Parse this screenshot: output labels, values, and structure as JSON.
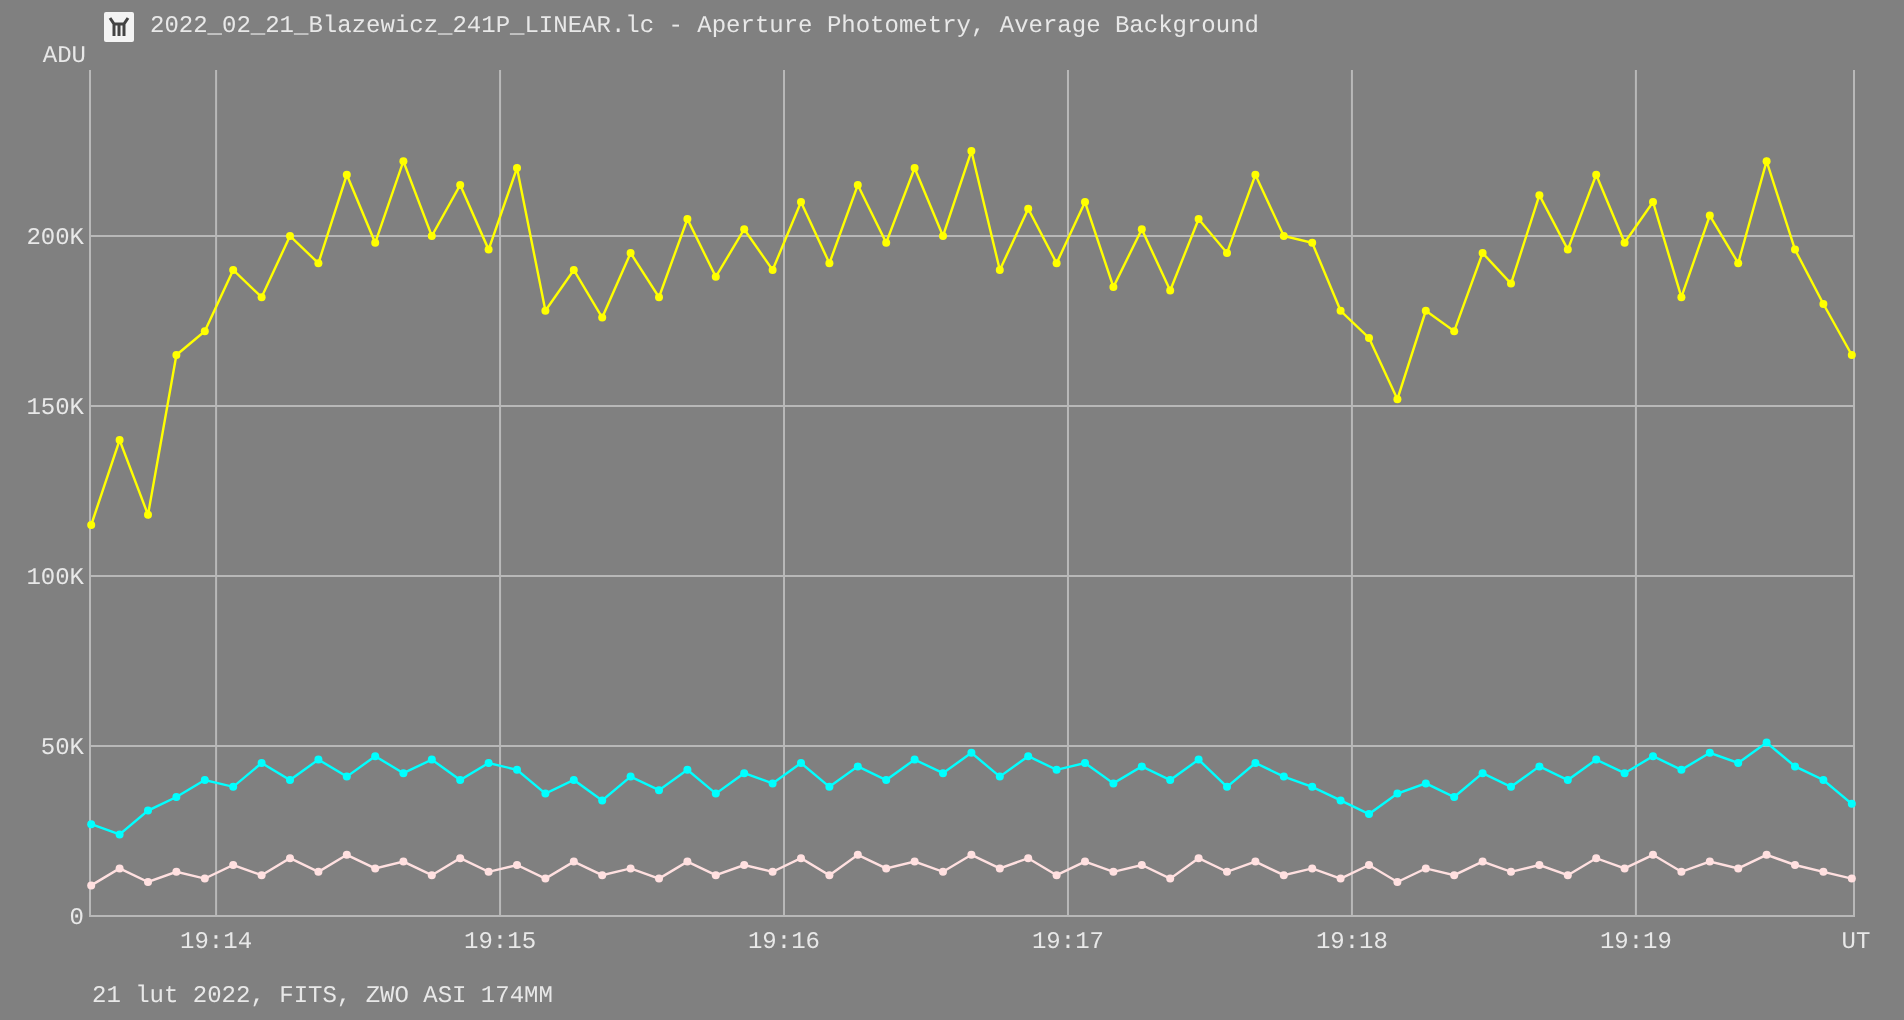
{
  "window": {
    "title": "2022_02_21_Blazewicz_241P_LINEAR.lc - Aperture Photometry, Average Background"
  },
  "chart": {
    "chart_data": {
      "type": "line",
      "grid": true,
      "ylabel": "ADU",
      "xlabel": "UT",
      "xlim": [
        1153.556,
        1159.768
      ],
      "ylim": [
        0,
        248800
      ],
      "x": [
        1153.56,
        1153.66,
        1153.76,
        1153.86,
        1153.96,
        1154.06,
        1154.16,
        1154.26,
        1154.36,
        1154.46,
        1154.56,
        1154.66,
        1154.76,
        1154.86,
        1154.96,
        1155.06,
        1155.16,
        1155.26,
        1155.36,
        1155.46,
        1155.56,
        1155.66,
        1155.76,
        1155.86,
        1155.96,
        1156.06,
        1156.16,
        1156.26,
        1156.36,
        1156.46,
        1156.56,
        1156.66,
        1156.76,
        1156.86,
        1156.96,
        1157.06,
        1157.16,
        1157.26,
        1157.36,
        1157.46,
        1157.56,
        1157.66,
        1157.76,
        1157.86,
        1157.96,
        1158.06,
        1158.16,
        1158.26,
        1158.36,
        1158.46,
        1158.56,
        1158.66,
        1158.76,
        1158.86,
        1158.96,
        1159.06,
        1159.16,
        1159.26,
        1159.36,
        1159.46,
        1159.56,
        1159.66,
        1159.76
      ],
      "xticks": [
        {
          "value": 1154,
          "label": "19:14"
        },
        {
          "value": 1155,
          "label": "19:15"
        },
        {
          "value": 1156,
          "label": "19:16"
        },
        {
          "value": 1157,
          "label": "19:17"
        },
        {
          "value": 1158,
          "label": "19:18"
        },
        {
          "value": 1159,
          "label": "19:19"
        }
      ],
      "yticks": [
        0,
        {
          "value": 50000,
          "label": "50K"
        },
        {
          "value": 100000,
          "label": "100K"
        },
        {
          "value": 150000,
          "label": "150K"
        },
        {
          "value": 200000,
          "label": "200K"
        }
      ],
      "series": [
        {
          "color": "#ffff00",
          "values": [
            115000,
            140000,
            118000,
            165000,
            172000,
            190000,
            182000,
            200000,
            192000,
            218000,
            198000,
            222000,
            200000,
            215000,
            196000,
            220000,
            178000,
            190000,
            176000,
            195000,
            182000,
            205000,
            188000,
            202000,
            190000,
            210000,
            192000,
            215000,
            198000,
            220000,
            200000,
            225000,
            190000,
            208000,
            192000,
            210000,
            185000,
            202000,
            184000,
            205000,
            195000,
            218000,
            200000,
            198000,
            178000,
            170000,
            152000,
            178000,
            172000,
            195000,
            186000,
            212000,
            196000,
            218000,
            198000,
            210000,
            182000,
            206000,
            192000,
            222000,
            196000,
            180000,
            165000
          ]
        },
        {
          "color": "#00ffff",
          "values": [
            27000,
            24000,
            31000,
            35000,
            40000,
            38000,
            45000,
            40000,
            46000,
            41000,
            47000,
            42000,
            46000,
            40000,
            45000,
            43000,
            36000,
            40000,
            34000,
            41000,
            37000,
            43000,
            36000,
            42000,
            39000,
            45000,
            38000,
            44000,
            40000,
            46000,
            42000,
            48000,
            41000,
            47000,
            43000,
            45000,
            39000,
            44000,
            40000,
            46000,
            38000,
            45000,
            41000,
            38000,
            34000,
            30000,
            36000,
            39000,
            35000,
            42000,
            38000,
            44000,
            40000,
            46000,
            42000,
            47000,
            43000,
            48000,
            45000,
            51000,
            44000,
            40000,
            33000
          ]
        },
        {
          "color": "#ffe0e0",
          "values": [
            9000,
            14000,
            10000,
            13000,
            11000,
            15000,
            12000,
            17000,
            13000,
            18000,
            14000,
            16000,
            12000,
            17000,
            13000,
            15000,
            11000,
            16000,
            12000,
            14000,
            11000,
            16000,
            12000,
            15000,
            13000,
            17000,
            12000,
            18000,
            14000,
            16000,
            13000,
            18000,
            14000,
            17000,
            12000,
            16000,
            13000,
            15000,
            11000,
            17000,
            13000,
            16000,
            12000,
            14000,
            11000,
            15000,
            10000,
            14000,
            12000,
            16000,
            13000,
            15000,
            12000,
            17000,
            14000,
            18000,
            13000,
            16000,
            14000,
            18000,
            15000,
            13000,
            11000
          ]
        }
      ]
    }
  },
  "footer": "21 lut 2022, FITS, ZWO ASI 174MM"
}
